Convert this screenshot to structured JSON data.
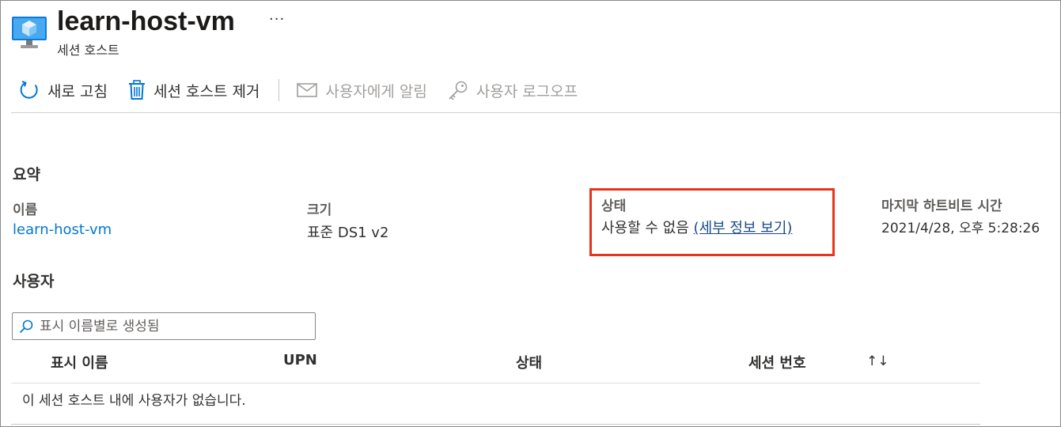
{
  "header": {
    "title": "learn-host-vm",
    "subtitle": "세션 호스트",
    "more_label": "···"
  },
  "toolbar": {
    "refresh_label": "새로 고침",
    "remove_label": "세션 호스트 제거",
    "notify_label": "사용자에게 알림",
    "logoff_label": "사용자 로그오프"
  },
  "summary": {
    "heading": "요약",
    "name_label": "이름",
    "name_value": "learn-host-vm",
    "size_label": "크기",
    "size_value": "표준 DS1 v2",
    "status_label": "상태",
    "status_value": "사용할 수 없음",
    "status_link": "(세부 정보 보기)",
    "heartbeat_label": "마지막 하트비트 시간",
    "heartbeat_value": "2021/4/28, 오후 5:28:26"
  },
  "users": {
    "heading": "사용자",
    "search_placeholder": "표시 이름별로 생성됨",
    "columns": [
      "표시 이름",
      "UPN",
      "상태",
      "세션 번호"
    ],
    "sort_glyph": "↑↓",
    "empty_message": "이 세션 호스트 내에 사용자가 없습니다."
  },
  "colors": {
    "accent": "#0078d4",
    "highlight": "#e8341c",
    "disabled": "#a19f9d"
  },
  "icons": [
    "vm-icon",
    "refresh-icon",
    "trash-icon",
    "mail-icon",
    "key-icon",
    "search-icon",
    "sort-icon"
  ]
}
